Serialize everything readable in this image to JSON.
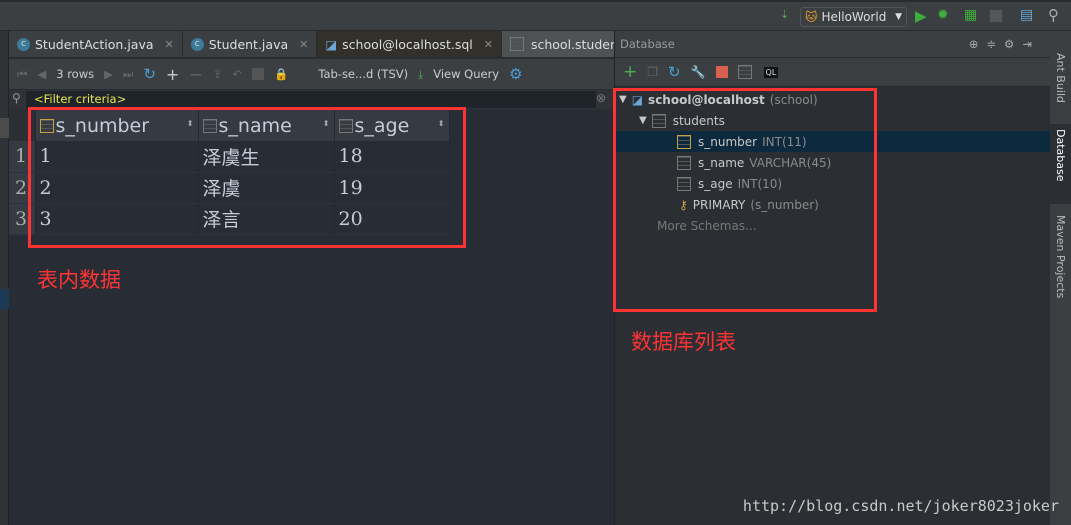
{
  "topbar": {
    "run_config": "HelloWorld"
  },
  "tabs": [
    {
      "label": "StudentAction.java",
      "icon": "class-icon"
    },
    {
      "label": "Student.java",
      "icon": "class-icon"
    },
    {
      "label": "school@localhost.sql",
      "icon": "mysql-icon"
    },
    {
      "label": "school.students",
      "icon": "table-icon",
      "active": true
    }
  ],
  "toolbar": {
    "rows": "3 rows",
    "export_format": "Tab-se...d (TSV)",
    "view_query": "View Query"
  },
  "filter": {
    "placeholder": "<Filter criteria>"
  },
  "grid": {
    "columns": [
      "s_number",
      "s_name",
      "s_age"
    ],
    "rows": [
      {
        "n": "1",
        "cells": [
          "1",
          "泽虞生",
          "18"
        ]
      },
      {
        "n": "2",
        "cells": [
          "2",
          "泽虞",
          "19"
        ]
      },
      {
        "n": "3",
        "cells": [
          "3",
          "泽言",
          "20"
        ]
      }
    ]
  },
  "annotations": {
    "table": "表内数据",
    "db": "数据库列表"
  },
  "db": {
    "title": "Database",
    "datasource": "school@localhost",
    "schema": "(school)",
    "table": "students",
    "columns": [
      {
        "name": "s_number",
        "type": "INT(11)"
      },
      {
        "name": "s_name",
        "type": "VARCHAR(45)"
      },
      {
        "name": "s_age",
        "type": "INT(10)"
      }
    ],
    "key": {
      "name": "PRIMARY",
      "cols": "(s_number)"
    },
    "more": "More Schemas..."
  },
  "side_tools": [
    "Ant Build",
    "Database",
    "Maven Projects"
  ],
  "watermark": "http://blog.csdn.net/joker8023joker",
  "colors": {
    "annotation": "#ff3333",
    "selection": "#0d293e",
    "filter_text": "#e8e84c"
  }
}
